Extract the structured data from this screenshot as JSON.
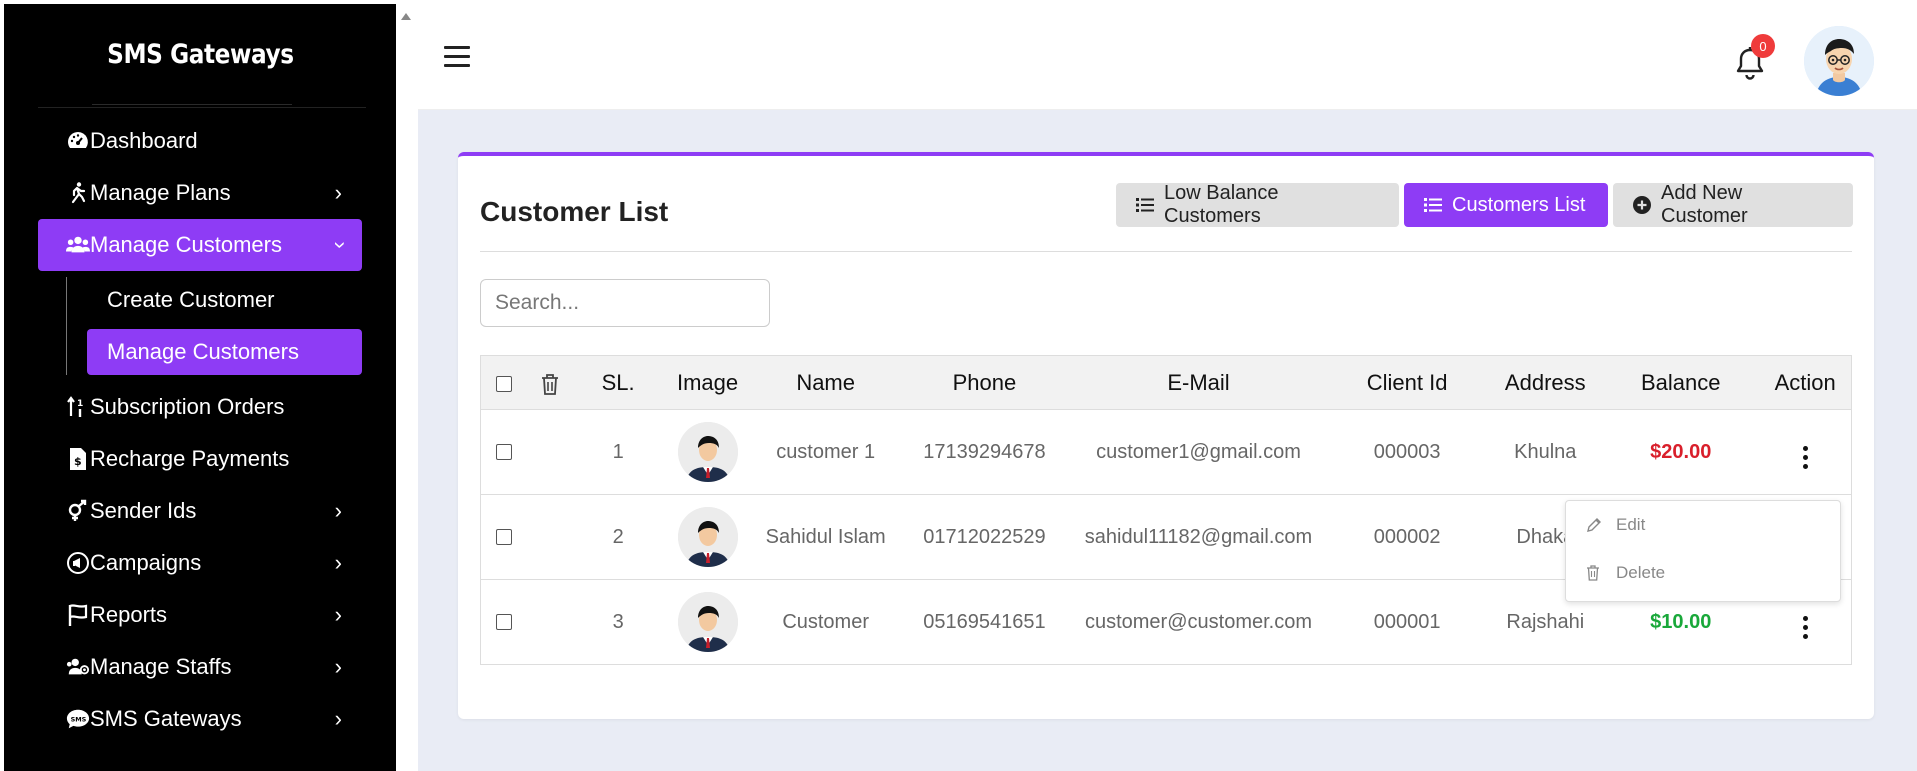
{
  "sidebar": {
    "brand": "SMS Gateways",
    "items": [
      {
        "label": "Dashboard",
        "icon": "tachometer-icon",
        "has_children": false
      },
      {
        "label": "Manage Plans",
        "icon": "walking-icon",
        "has_children": true
      },
      {
        "label": "Manage Customers",
        "icon": "users-icon",
        "has_children": true,
        "active": true,
        "expanded": true
      },
      {
        "label": "Subscription Orders",
        "icon": "sort-icon",
        "has_children": false
      },
      {
        "label": "Recharge Payments",
        "icon": "invoice-icon",
        "has_children": false
      },
      {
        "label": "Sender Ids",
        "icon": "venus-mars-icon",
        "has_children": true
      },
      {
        "label": "Campaigns",
        "icon": "bullhorn-icon",
        "has_children": true
      },
      {
        "label": "Reports",
        "icon": "flag-icon",
        "has_children": true
      },
      {
        "label": "Manage Staffs",
        "icon": "staff-icon",
        "has_children": true
      },
      {
        "label": "SMS Gateways",
        "icon": "sms-icon",
        "has_children": true
      }
    ],
    "submenu": [
      {
        "label": "Create Customer",
        "active": false
      },
      {
        "label": "Manage Customers",
        "active": true
      }
    ]
  },
  "topbar": {
    "notification_count": "0"
  },
  "card": {
    "title": "Customer List",
    "buttons": {
      "low_balance": "Low Balance Customers",
      "customers_list": "Customers List",
      "add_new": "Add New Customer"
    },
    "search_placeholder": "Search..."
  },
  "table": {
    "columns": [
      "SL.",
      "Image",
      "Name",
      "Phone",
      "E-Mail",
      "Client Id",
      "Address",
      "Balance",
      "Action"
    ],
    "rows": [
      {
        "sl": "1",
        "name": "customer 1",
        "phone": "17139294678",
        "email": "customer1@gmail.com",
        "client_id": "000003",
        "address": "Khulna",
        "balance": "$20.00",
        "balance_color": "#d91f2b"
      },
      {
        "sl": "2",
        "name": "Sahidul Islam",
        "phone": "01712022529",
        "email": "sahidul11182@gmail.com",
        "client_id": "000002",
        "address": "Dhaka",
        "balance": "",
        "balance_color": ""
      },
      {
        "sl": "3",
        "name": "Customer",
        "phone": "05169541651",
        "email": "customer@customer.com",
        "client_id": "000001",
        "address": "Rajshahi",
        "balance": "$10.00",
        "balance_color": "#19a83a"
      }
    ]
  },
  "dropdown": {
    "edit": "Edit",
    "delete": "Delete"
  },
  "colors": {
    "accent": "#8e3cf5",
    "badge": "#ef3b3b",
    "balance_low": "#d91f2b",
    "balance_ok": "#19a83a"
  }
}
